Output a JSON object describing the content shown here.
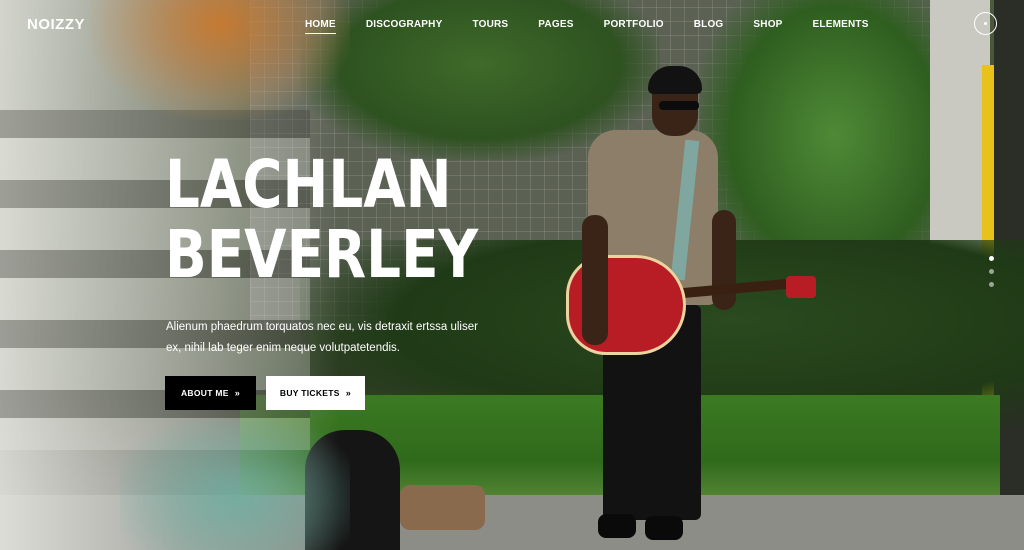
{
  "header": {
    "logo": "NOIZZY",
    "nav": [
      {
        "label": "HOME",
        "active": true
      },
      {
        "label": "DISCOGRAPHY",
        "active": false
      },
      {
        "label": "TOURS",
        "active": false
      },
      {
        "label": "PAGES",
        "active": false
      },
      {
        "label": "PORTFOLIO",
        "active": false
      },
      {
        "label": "BLOG",
        "active": false
      },
      {
        "label": "SHOP",
        "active": false
      },
      {
        "label": "ELEMENTS",
        "active": false
      }
    ],
    "menu_icon": "circle-menu-icon"
  },
  "hero": {
    "title_line1": "LACHLAN",
    "title_line2": "BEVERLEY",
    "description_line1": "Alienum phaedrum torquatos nec eu, vis detraxit ertssa uliser",
    "description_line2": "ex, nihil lab teger enim neque volutpatetendis.",
    "buttons": {
      "about": {
        "label": "ABOUT ME",
        "arrow": "»"
      },
      "tickets": {
        "label": "BUY TICKETS",
        "arrow": "»"
      }
    }
  },
  "slider": {
    "dots": 3,
    "active_index": 0
  },
  "colors": {
    "text": "#ffffff",
    "button_dark": "#000000",
    "button_light": "#ffffff",
    "pole_accent": "#e6c21a"
  }
}
